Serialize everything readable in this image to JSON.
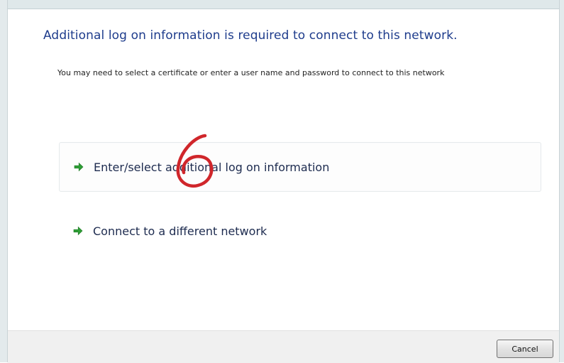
{
  "dialog": {
    "main_instruction": "Additional log on information is required to connect to this network.",
    "description": "You may need to select a certificate or enter a user name and password to connect to this network"
  },
  "options": [
    {
      "label": "Enter/select additional log on information",
      "icon": "green-arrow-icon"
    },
    {
      "label": "Connect to a different network",
      "icon": "green-arrow-icon"
    }
  ],
  "footer": {
    "cancel_label": "Cancel"
  },
  "annotation": {
    "icon": "red-circle-annotation",
    "color": "#d0262b"
  },
  "colors": {
    "instruction_text": "#1e3c8c",
    "arrow_green": "#2e9e35"
  }
}
